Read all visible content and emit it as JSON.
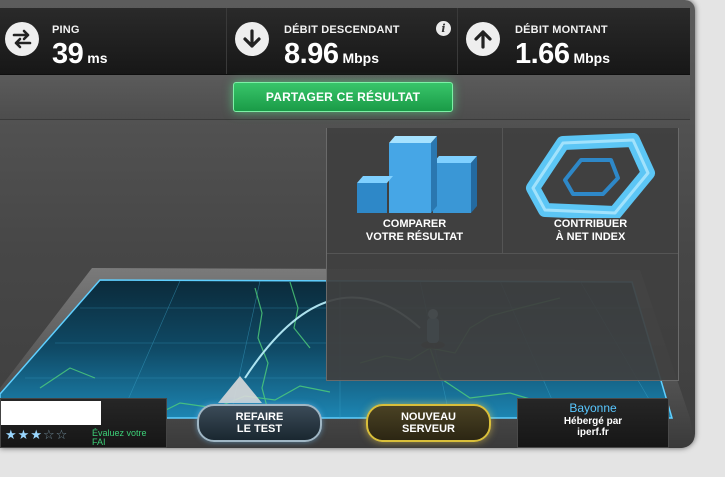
{
  "stats": {
    "ping": {
      "label": "PING",
      "value": "39",
      "unit": "ms",
      "icon": "swap-arrows-icon"
    },
    "download": {
      "label": "DÉBIT DESCENDANT",
      "value": "8.96",
      "unit": "Mbps",
      "icon": "arrow-down-icon",
      "info": "i"
    },
    "upload": {
      "label": "DÉBIT MONTANT",
      "value": "1.66",
      "unit": "Mbps",
      "icon": "arrow-up-icon"
    }
  },
  "share": {
    "label": "PARTAGER CE RÉSULTAT"
  },
  "cards": {
    "compare": {
      "label": "COMPARER\nVOTRE RÉSULTAT"
    },
    "contribute": {
      "label": "CONTRIBUER\nÀ NET INDEX"
    }
  },
  "actions": {
    "retest": "REFAIRE\nLE TEST",
    "new_server": "NOUVEAU\nSERVEUR"
  },
  "rating": {
    "text": "Évaluez votre FAI",
    "stars_filled": 3,
    "stars_total": 5
  },
  "server": {
    "city": "Bayonne",
    "hosted_by": "Hébergé par\niperf.fr"
  },
  "colors": {
    "accent_green": "#2dbb63",
    "accent_blue": "#3fb8ff",
    "accent_gold": "#d9bf3a"
  }
}
